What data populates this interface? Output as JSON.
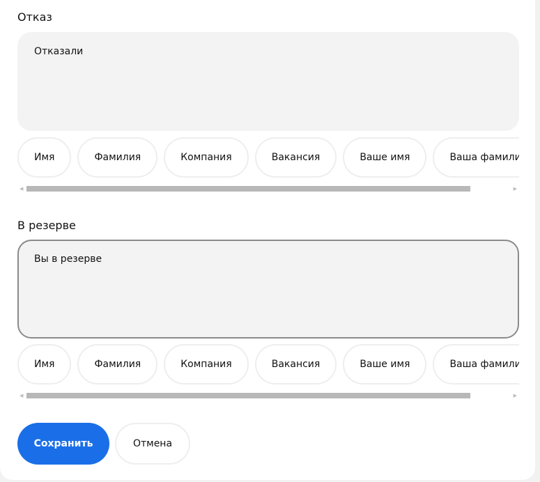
{
  "sections": [
    {
      "title": "Отказ",
      "text": "Отказали"
    },
    {
      "title": "В резерве",
      "text": "Вы в резерве"
    }
  ],
  "chips": [
    "Имя",
    "Фамилия",
    "Компания",
    "Вакансия",
    "Ваше имя",
    "Ваша фамилия"
  ],
  "buttons": {
    "save": "Сохранить",
    "cancel": "Отмена"
  },
  "colors": {
    "accent": "#1a6fe8"
  }
}
